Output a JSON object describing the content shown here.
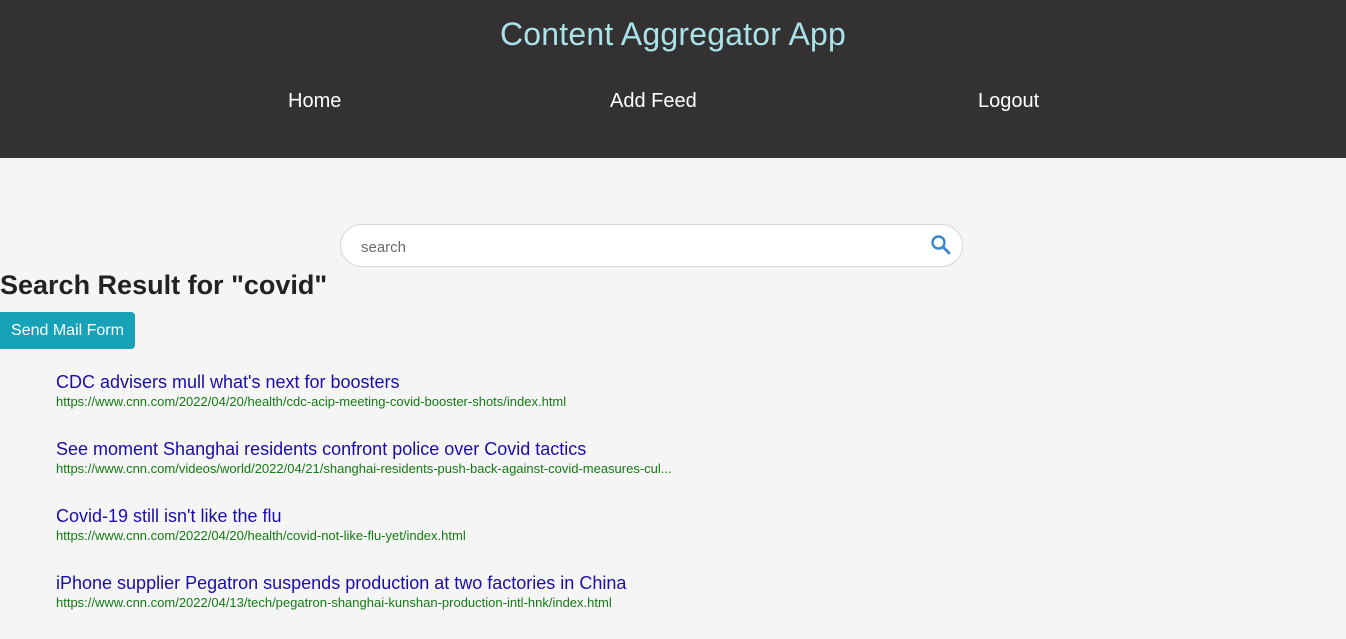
{
  "header": {
    "title": "Content Aggregator App",
    "nav": {
      "home": "Home",
      "add_feed": "Add Feed",
      "logout": "Logout"
    }
  },
  "search": {
    "placeholder": "search",
    "value": "",
    "icon": "search-icon"
  },
  "results_section": {
    "heading": "Search Result for \"covid\"",
    "send_mail_label": "Send Mail Form",
    "items": [
      {
        "title": "CDC advisers mull what's next for boosters",
        "url": "https://www.cnn.com/2022/04/20/health/cdc-acip-meeting-covid-booster-shots/index.html"
      },
      {
        "title": "See moment Shanghai residents confront police over Covid tactics",
        "url": "https://www.cnn.com/videos/world/2022/04/21/shanghai-residents-push-back-against-covid-measures-cul..."
      },
      {
        "title": "Covid-19 still isn't like the flu",
        "url": "https://www.cnn.com/2022/04/20/health/covid-not-like-flu-yet/index.html"
      },
      {
        "title": "iPhone supplier Pegatron suspends production at two factories in China",
        "url": "https://www.cnn.com/2022/04/13/tech/pegatron-shanghai-kunshan-production-intl-hnk/index.html"
      }
    ]
  },
  "colors": {
    "header_bg": "#333131",
    "title_color": "#a9e2e8",
    "accent": "#17a2b8",
    "link": "#1a0dab",
    "url": "#137a13"
  }
}
